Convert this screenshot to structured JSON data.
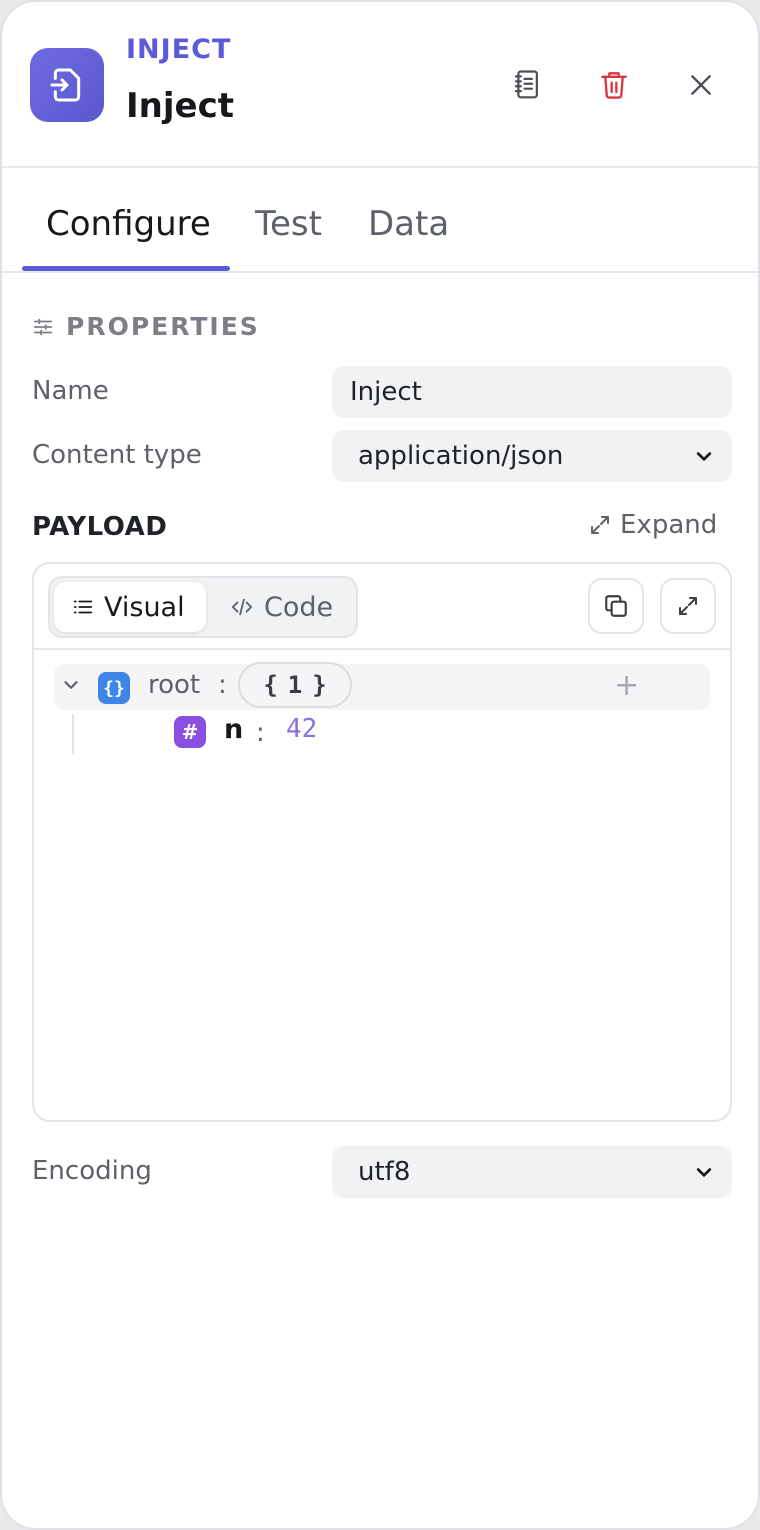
{
  "header": {
    "node_type": "INJECT",
    "node_title": "Inject",
    "colors": {
      "accent": "#5c5ad8",
      "delete": "#d9363e"
    }
  },
  "tabs": [
    {
      "label": "Configure",
      "active": true
    },
    {
      "label": "Test",
      "active": false
    },
    {
      "label": "Data",
      "active": false
    }
  ],
  "properties": {
    "section_title": "PROPERTIES",
    "name": {
      "label": "Name",
      "value": "Inject"
    },
    "content_type": {
      "label": "Content type",
      "value": "application/json"
    },
    "encoding": {
      "label": "Encoding",
      "value": "utf8"
    }
  },
  "payload": {
    "label": "PAYLOAD",
    "expand_label": "Expand",
    "modes": {
      "visual": "Visual",
      "code": "Code",
      "active": "Visual"
    },
    "tree": {
      "root_key": "root",
      "root_badge": "{}",
      "root_count": "1",
      "child_key": "n",
      "child_badge": "#",
      "child_value": "42"
    }
  }
}
